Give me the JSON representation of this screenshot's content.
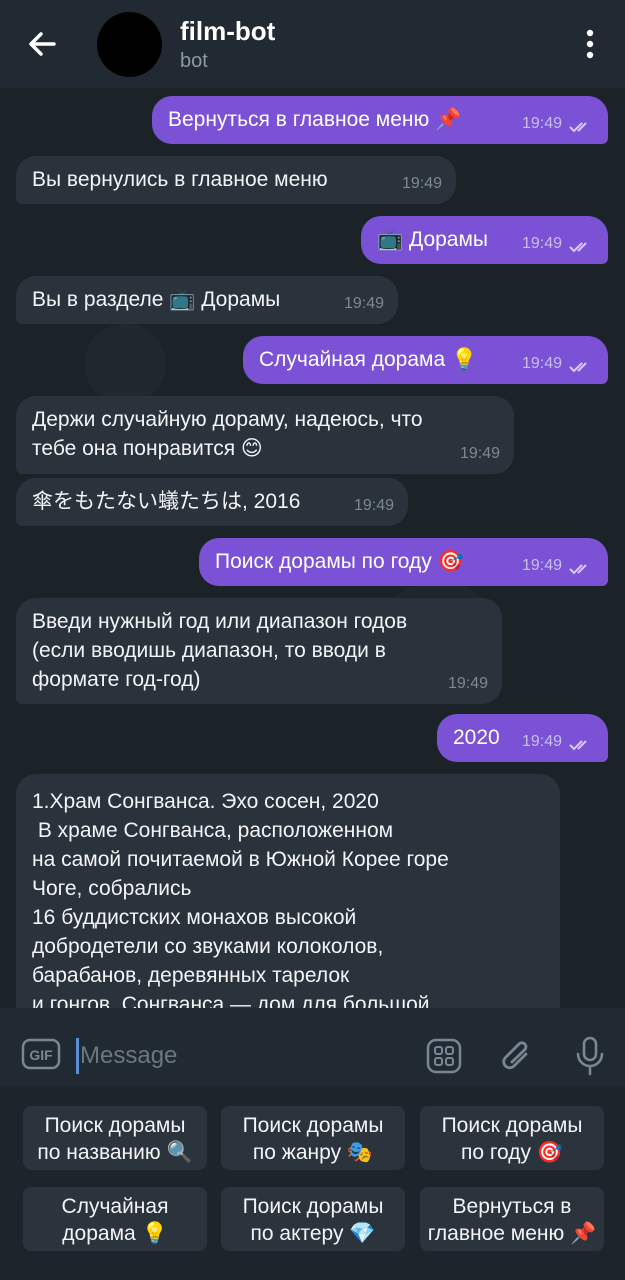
{
  "header": {
    "title": "film-bot",
    "subtitle": "bot"
  },
  "messages": [
    {
      "dir": "out",
      "text": "Вернуться в главное меню 📌",
      "time": "19:49"
    },
    {
      "dir": "in",
      "text": "Вы вернулись в главное меню",
      "time": "19:49"
    },
    {
      "dir": "out",
      "text": "📺 Дорамы",
      "time": "19:49"
    },
    {
      "dir": "in",
      "text": "Вы в разделе 📺 Дорамы",
      "time": "19:49"
    },
    {
      "dir": "out",
      "text": "Случайная дорама 💡",
      "time": "19:49"
    },
    {
      "dir": "in",
      "text": "Держи случайную дораму, надеюсь, что\nтебе она понравится 😊",
      "time": "19:49"
    },
    {
      "dir": "in",
      "text": "傘をもたない蟻たちは, 2016",
      "time": "19:49"
    },
    {
      "dir": "out",
      "text": "Поиск дорамы по году 🎯",
      "time": "19:49"
    },
    {
      "dir": "in",
      "text": "Введи нужный год или диапазон годов\n(если вводишь диапазон, то вводи в\nформате год-год)",
      "time": "19:49"
    },
    {
      "dir": "out",
      "text": "2020",
      "time": "19:49"
    },
    {
      "dir": "in",
      "text": "1.Храм Сонгванса. Эхо сосен, 2020\n В храме Сонгванса, расположенном\nна самой почитаемой в Южной Корее горе\nЧоге, собрались\n16 буддистских монахов высокой\nдобродетели со звуками колоколов,\nбарабанов, деревянных тарелок\nи гонгов. Сонгванса — дом для большой",
      "time": ""
    }
  ],
  "input": {
    "placeholder": "Message",
    "gif_label": "GIF"
  },
  "keyboard": [
    {
      "label": "Поиск дорамы\nпо названию 🔍"
    },
    {
      "label": "Поиск дорамы\nпо жанру 🎭"
    },
    {
      "label": "Поиск дорамы\nпо году 🎯"
    },
    {
      "label": "Случайная\nдорама 💡"
    },
    {
      "label": "Поиск дорамы\nпо актеру 💎"
    },
    {
      "label": "Вернуться в\nглавное меню 📌"
    }
  ],
  "icons": {
    "back": "arrow-left-icon",
    "menu": "more-vertical-icon",
    "gif": "gif-icon",
    "apps": "apps-grid-icon",
    "attach": "paperclip-icon",
    "mic": "microphone-icon",
    "read": "double-check-icon"
  },
  "colors": {
    "outgoing_bubble": "#7b52d6",
    "incoming_bubble": "#2a323c",
    "header_bg": "#212a33",
    "chat_bg": "#1b2228"
  }
}
